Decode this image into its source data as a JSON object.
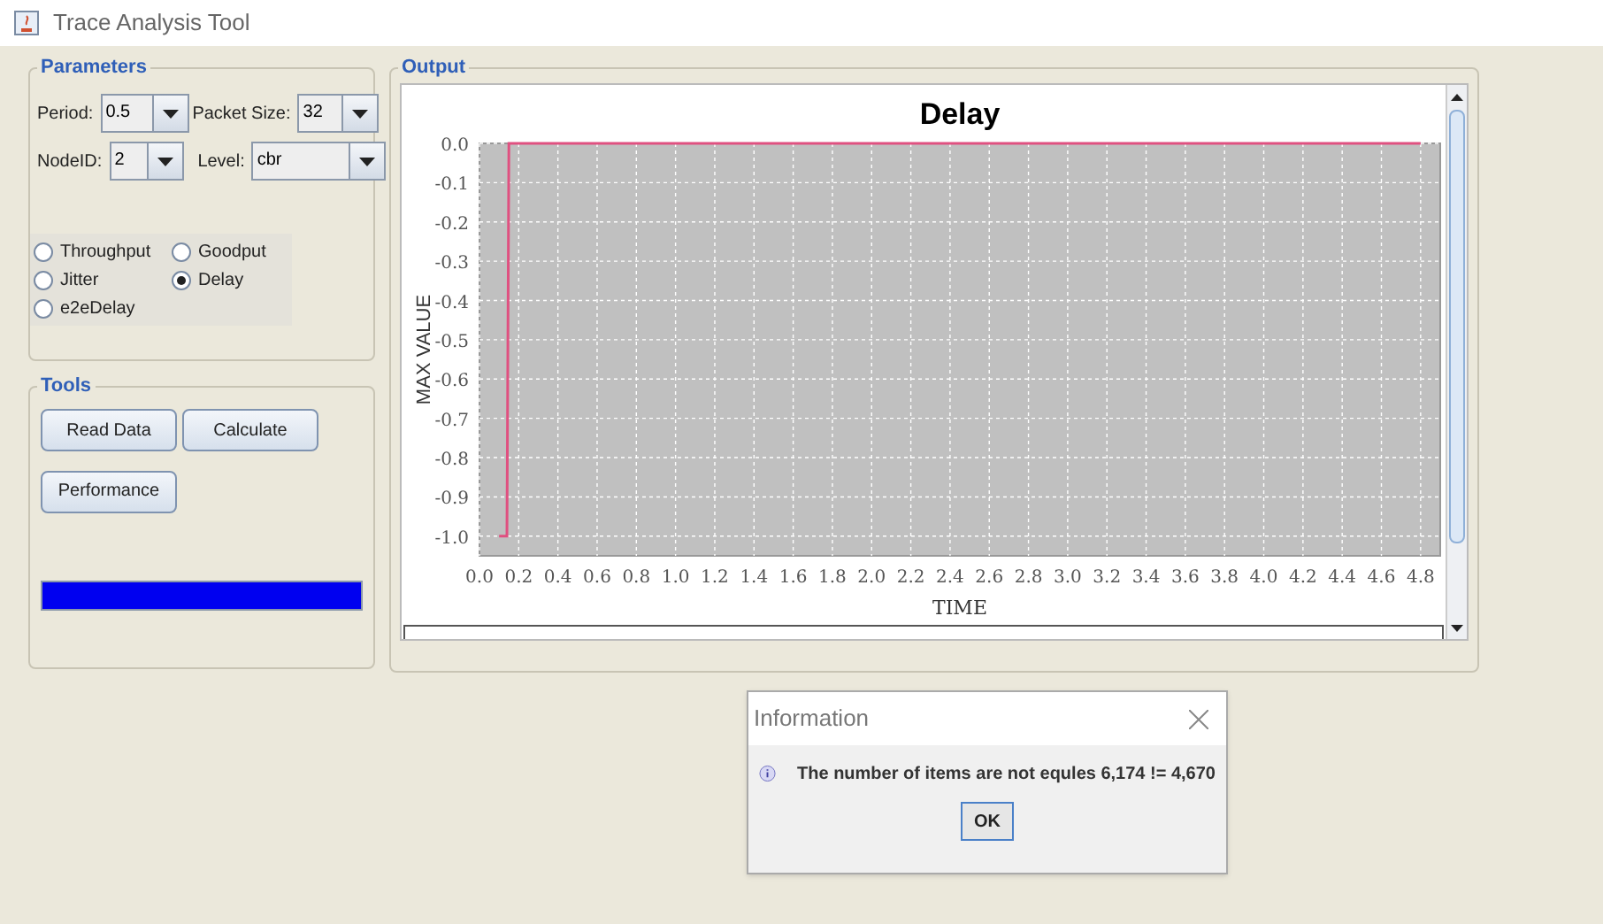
{
  "window": {
    "title": "Trace Analysis Tool"
  },
  "parameters": {
    "title": "Parameters",
    "fields": [
      {
        "label": "Period:",
        "value": "0.5"
      },
      {
        "label": "Packet Size:",
        "value": "32"
      },
      {
        "label": "NodeID:",
        "value": "2"
      },
      {
        "label": "Level:",
        "value": "cbr"
      }
    ],
    "metrics": [
      {
        "label": "Throughput",
        "selected": false
      },
      {
        "label": "Goodput",
        "selected": false
      },
      {
        "label": "Jitter",
        "selected": false
      },
      {
        "label": "Delay",
        "selected": true
      },
      {
        "label": "e2eDelay",
        "selected": false
      }
    ]
  },
  "tools": {
    "title": "Tools",
    "buttons": [
      "Read Data",
      "Calculate",
      "Performance"
    ],
    "progress": {
      "level": 1
    }
  },
  "output": {
    "title": "Output",
    "chart_data": {
      "type": "line",
      "title": "Delay",
      "xlabel": "TIME",
      "ylabel": "MAX VALUE",
      "grid": true,
      "x": [
        0.1,
        0.14,
        0.15,
        4.8
      ],
      "series": [
        {
          "color": "#e05080",
          "values": [
            -1,
            -1,
            0,
            0
          ]
        }
      ],
      "xlim": [
        0,
        4.9
      ],
      "ylim": [
        -1.05,
        0
      ],
      "xticks": [
        {
          "value": 0,
          "label": "0.0"
        },
        0.2,
        0.4,
        0.6,
        0.8,
        {
          "value": 1,
          "label": "1.0"
        },
        1.2,
        1.4,
        1.6,
        1.8,
        {
          "value": 2,
          "label": "2.0"
        },
        2.2,
        2.4,
        2.6,
        2.8,
        {
          "value": 3,
          "label": "3.0"
        },
        3.2,
        3.4,
        3.6,
        3.8,
        {
          "value": 4,
          "label": "4.0"
        },
        4.2,
        4.4,
        4.6,
        4.8
      ],
      "yticks": [
        {
          "value": 0,
          "label": "0.0"
        },
        -0.1,
        -0.2,
        -0.3,
        -0.4,
        -0.5,
        -0.6,
        -0.7,
        -0.8,
        -0.9,
        {
          "value": -1,
          "label": "-1.0"
        }
      ]
    }
  },
  "dialog": {
    "title": "Information",
    "message": "The number of items are not equles 6,174 != 4,670",
    "button": "OK"
  }
}
